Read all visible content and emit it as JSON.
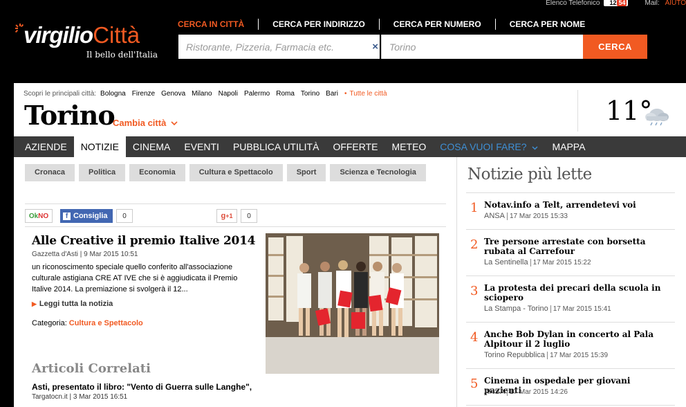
{
  "top_links": {
    "elenco_label": "Elenco Telefonico",
    "elenco_badge_a": "12",
    "elenco_badge_b": "54",
    "mail_label": "Mail",
    "aiuto_label": "AIUTO"
  },
  "logo": {
    "brand_a": "virgilio",
    "brand_b": "Città",
    "tagline": "Il bello dell'Italia"
  },
  "search": {
    "tabs": [
      "CERCA IN CITTÀ",
      "CERCA PER INDIRIZZO",
      "CERCA PER NUMERO",
      "CERCA PER NOME"
    ],
    "what_placeholder": "Ristorante, Pizzeria, Farmacia etc.",
    "where_value": "Torino",
    "button_label": "CERCA",
    "clear_glyph": "×"
  },
  "cities": {
    "label": "Scopri le principali città:",
    "items": [
      "Bologna",
      "Firenze",
      "Genova",
      "Milano",
      "Napoli",
      "Palermo",
      "Roma",
      "Torino",
      "Bari"
    ],
    "all_label": "Tutte le città"
  },
  "city": {
    "name": "Torino",
    "change_label": "Cambia città"
  },
  "weather": {
    "temperature": "11°"
  },
  "nav": [
    "AZIENDE",
    "NOTIZIE",
    "CINEMA",
    "EVENTI",
    "PUBBLICA UTILITÀ",
    "OFFERTE",
    "METEO",
    "COSA VUOI FARE?",
    "MAPPA"
  ],
  "categories": [
    "Cronaca",
    "Politica",
    "Economia",
    "Cultura e Spettacolo",
    "Sport",
    "Scienza e Tecnologia"
  ],
  "share": {
    "ok": "Ok",
    "no": "NO",
    "fb_label": "Consiglia",
    "fb_count": "0",
    "gplus_label": "+1",
    "gplus_count": "0"
  },
  "article": {
    "title": "Alle Creative il premio Italive 2014",
    "source": "Gazzetta d'Asti",
    "date": "9 Mar 2015 10:51",
    "body": "un riconoscimento speciale quello conferito all'associazione culturale astigiana CRE AT IVE che  si è aggiudicata il Premio Italive 2014.  La premiazione si svolgerà il 12...",
    "read_more": "Leggi tutta la notizia",
    "category_label": "Categoria:",
    "category_value": "Cultura e Spettacolo"
  },
  "related": {
    "heading": "Articoli Correlati",
    "items": [
      {
        "title": "Asti, presentato il libro: \"Vento di Guerra sulle Langhe\",",
        "source": "Targatocn.it",
        "date": "3 Mar 2015 16:51"
      }
    ]
  },
  "top_news": {
    "heading": "Notizie più lette",
    "items": [
      {
        "rank": "1",
        "title": "Notav.info a Telt, arrendetevi voi",
        "source": "ANSA",
        "date": "17 Mar 2015 15:33"
      },
      {
        "rank": "2",
        "title": "Tre persone arrestate con borsetta rubata al Carrefour",
        "source": "La Sentinella",
        "date": "17 Mar 2015 15:22"
      },
      {
        "rank": "3",
        "title": "La protesta dei precari della scuola in sciopero",
        "source": "La Stampa - Torino",
        "date": "17 Mar 2015 15:41"
      },
      {
        "rank": "4",
        "title": "Anche Bob Dylan in concerto al Pala Alpitour il 2 luglio",
        "source": "Torino Repubblica",
        "date": "17 Mar 2015 15:39"
      },
      {
        "rank": "5",
        "title": "Cinema in ospedale per giovani pazienti",
        "source": "ANSA",
        "date": "17 Mar 2015 14:26"
      }
    ]
  },
  "colors": {
    "accent": "#f15a22",
    "nav_bg": "#3a3a3a",
    "nav_highlight": "#3f8fd4",
    "facebook": "#4267b2"
  }
}
